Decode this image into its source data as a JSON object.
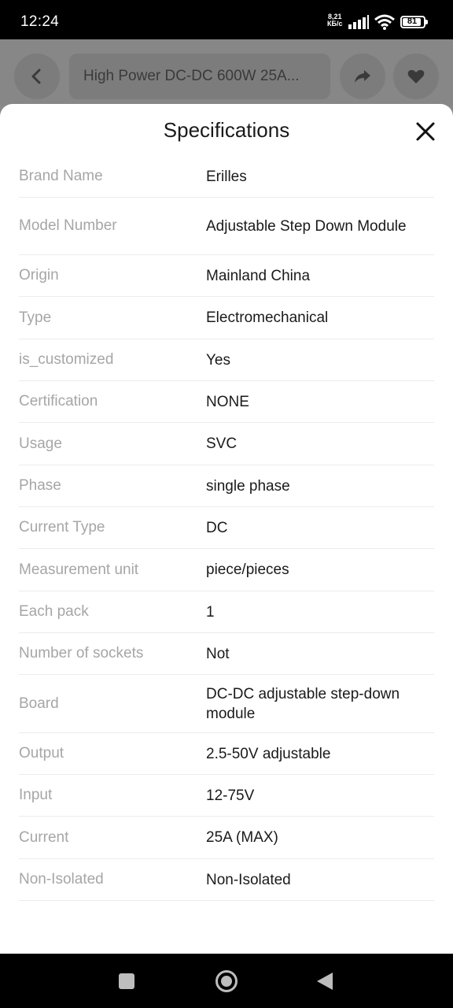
{
  "status_bar": {
    "time": "12:24",
    "net_speed_value": "8,21",
    "net_speed_unit": "КБ/с",
    "battery_level": "81"
  },
  "header": {
    "product_title": "High Power DC-DC 600W 25A...",
    "icons": [
      "back-chevron-icon",
      "share-icon",
      "heart-icon"
    ]
  },
  "sheet": {
    "title": "Specifications",
    "specs": [
      {
        "label": "Brand Name",
        "value": "Erilles"
      },
      {
        "label": "Model Number",
        "value": "Adjustable Step Down Module"
      },
      {
        "label": "Origin",
        "value": "Mainland China"
      },
      {
        "label": "Type",
        "value": "Electromechanical"
      },
      {
        "label": "is_customized",
        "value": "Yes"
      },
      {
        "label": "Certification",
        "value": "NONE"
      },
      {
        "label": "Usage",
        "value": "SVC"
      },
      {
        "label": "Phase",
        "value": "single phase"
      },
      {
        "label": "Current Type",
        "value": "DC"
      },
      {
        "label": "Measurement unit",
        "value": "piece/pieces"
      },
      {
        "label": "Each pack",
        "value": "1"
      },
      {
        "label": "Number of sockets",
        "value": "Not"
      },
      {
        "label": "Board",
        "value": "DC-DC adjustable step-down module"
      },
      {
        "label": "Output",
        "value": "2.5-50V adjustable"
      },
      {
        "label": "Input",
        "value": "12-75V"
      },
      {
        "label": "Current",
        "value": "25A (MAX)"
      },
      {
        "label": "Non-Isolated",
        "value": "Non-Isolated"
      }
    ]
  },
  "colors": {
    "label": "#a6a6a6",
    "value": "#1a1a1a",
    "divider": "#ececec",
    "overlay": "#878787"
  }
}
